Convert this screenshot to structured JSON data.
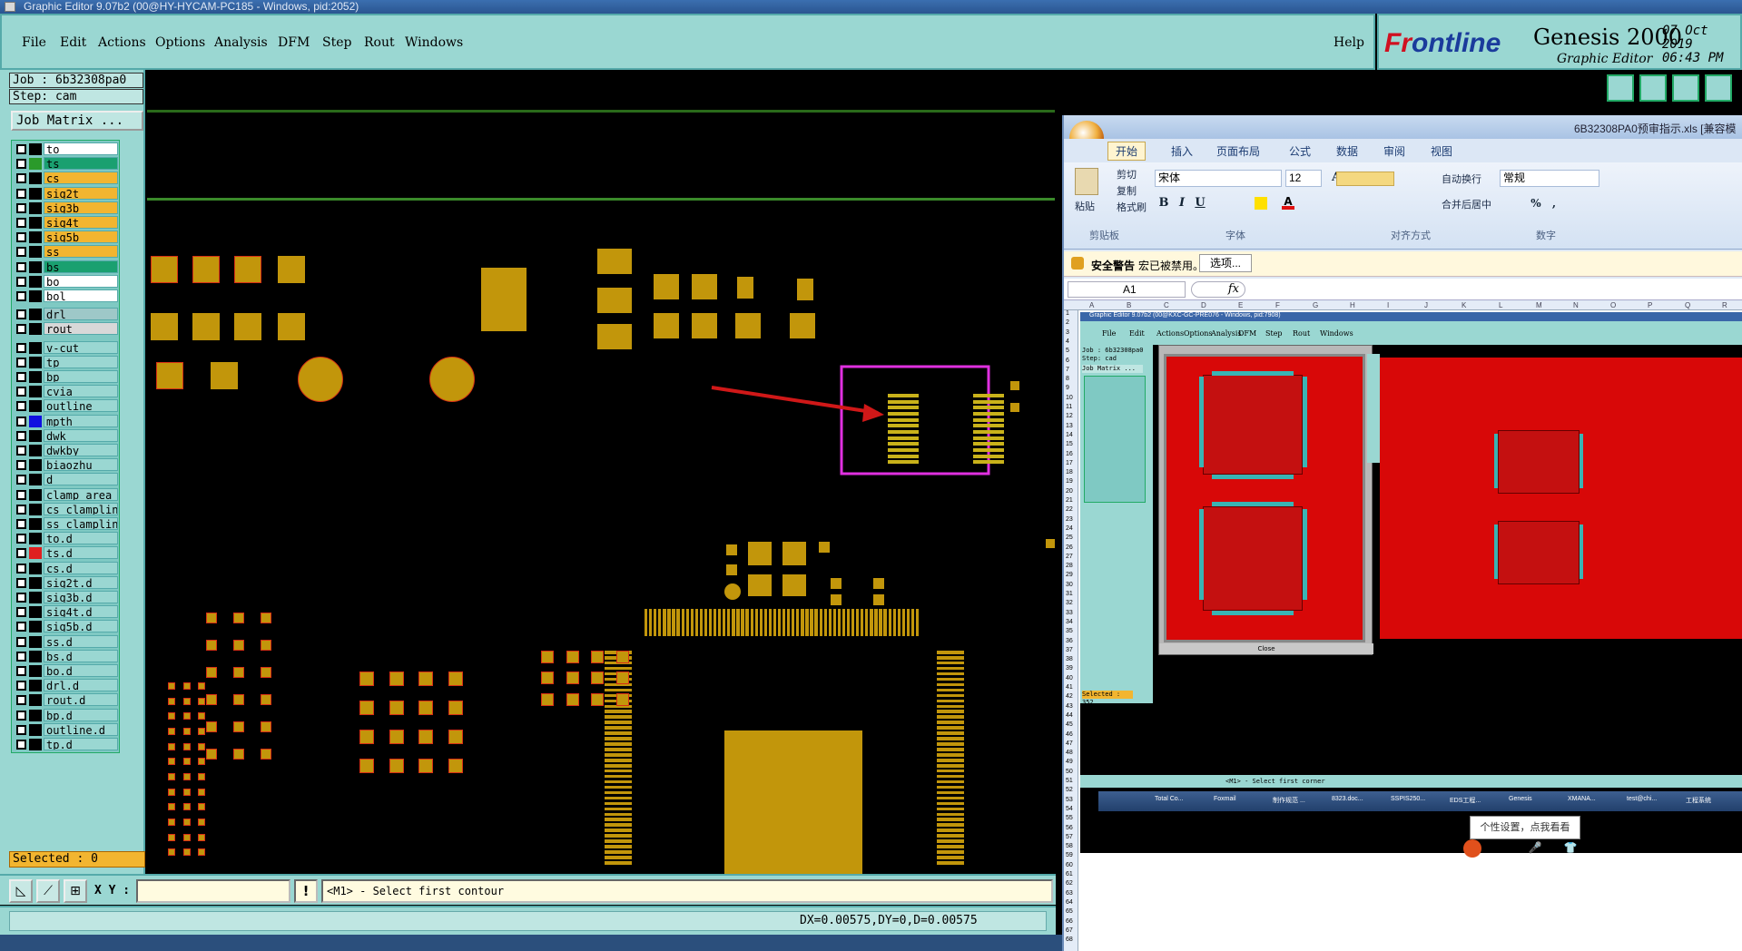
{
  "window": {
    "title": "Graphic Editor 9.07b2 (00@HY-HYCAM-PC185 - Windows, pid:2052)"
  },
  "menu": {
    "items": [
      "File",
      "Edit",
      "Actions",
      "Options",
      "Analysis",
      "DFM",
      "Step",
      "Rout",
      "Windows"
    ],
    "help": "Help"
  },
  "branding": {
    "logo_a": "Fr",
    "logo_b": "ontline",
    "product": "Genesis 2000",
    "subtitle": "Graphic Editor",
    "date": "07 Oct 2019",
    "time": "06:43 PM"
  },
  "job": {
    "job_label": "Job : 6b32308pa0",
    "step_label": "Step: cam",
    "matrix_button": "Job Matrix ..."
  },
  "layers": [
    {
      "name": "to",
      "color": "#ffffff",
      "sw": "#000000"
    },
    {
      "name": "ts",
      "color": "#1aa070",
      "sw": "#2a9a2a"
    },
    {
      "name": "cs",
      "color": "#f2b530",
      "sw": "#000000"
    },
    {
      "name": "sig2t",
      "color": "#f2b530",
      "sw": "#000000"
    },
    {
      "name": "sig3b",
      "color": "#f2b530",
      "sw": "#000000"
    },
    {
      "name": "sig4t",
      "color": "#f2b530",
      "sw": "#000000"
    },
    {
      "name": "sig5b",
      "color": "#f2b530",
      "sw": "#000000"
    },
    {
      "name": "ss",
      "color": "#f2b530",
      "sw": "#000000"
    },
    {
      "name": "bs",
      "color": "#1aa070",
      "sw": "#000000"
    },
    {
      "name": "bo",
      "color": "#ffffff",
      "sw": "#000000"
    },
    {
      "name": "bol",
      "color": "#ffffff",
      "sw": "#000000"
    },
    {
      "name": "drl",
      "color": "#9ec8c8",
      "sw": "#000000"
    },
    {
      "name": "rout",
      "color": "#d8d8d8",
      "sw": "#000000"
    },
    {
      "name": "v-cut",
      "color": "#9ad7d2",
      "sw": "#000000"
    },
    {
      "name": "tp",
      "color": "#9ad7d2",
      "sw": "#000000"
    },
    {
      "name": "bp",
      "color": "#9ad7d2",
      "sw": "#000000"
    },
    {
      "name": "cvia",
      "color": "#9ad7d2",
      "sw": "#000000"
    },
    {
      "name": "outline",
      "color": "#9ad7d2",
      "sw": "#000000"
    },
    {
      "name": "mpth",
      "color": "#9ad7d2",
      "sw": "#1010e0"
    },
    {
      "name": "dwk",
      "color": "#9ad7d2",
      "sw": "#000000"
    },
    {
      "name": "dwkby",
      "color": "#9ad7d2",
      "sw": "#000000"
    },
    {
      "name": "biaozhu",
      "color": "#9ad7d2",
      "sw": "#000000"
    },
    {
      "name": "d",
      "color": "#9ad7d2",
      "sw": "#000000"
    },
    {
      "name": "clamp_area",
      "color": "#9ad7d2",
      "sw": "#000000"
    },
    {
      "name": "cs_clampline",
      "color": "#9ad7d2",
      "sw": "#000000"
    },
    {
      "name": "ss_clampline",
      "color": "#9ad7d2",
      "sw": "#000000"
    },
    {
      "name": "to.d",
      "color": "#9ad7d2",
      "sw": "#000000"
    },
    {
      "name": "ts.d",
      "color": "#9ad7d2",
      "sw": "#e02020"
    },
    {
      "name": "cs.d",
      "color": "#9ad7d2",
      "sw": "#000000"
    },
    {
      "name": "sig2t.d",
      "color": "#9ad7d2",
      "sw": "#000000"
    },
    {
      "name": "sig3b.d",
      "color": "#9ad7d2",
      "sw": "#000000"
    },
    {
      "name": "sig4t.d",
      "color": "#9ad7d2",
      "sw": "#000000"
    },
    {
      "name": "sig5b.d",
      "color": "#9ad7d2",
      "sw": "#000000"
    },
    {
      "name": "ss.d",
      "color": "#9ad7d2",
      "sw": "#000000"
    },
    {
      "name": "bs.d",
      "color": "#9ad7d2",
      "sw": "#000000"
    },
    {
      "name": "bo.d",
      "color": "#9ad7d2",
      "sw": "#000000"
    },
    {
      "name": "drl.d",
      "color": "#9ad7d2",
      "sw": "#000000"
    },
    {
      "name": "rout.d",
      "color": "#9ad7d2",
      "sw": "#000000"
    },
    {
      "name": "bp.d",
      "color": "#9ad7d2",
      "sw": "#000000"
    },
    {
      "name": "outline.d",
      "color": "#9ad7d2",
      "sw": "#000000"
    },
    {
      "name": "tp.d",
      "color": "#9ad7d2",
      "sw": "#000000"
    }
  ],
  "selected": "Selected : 0",
  "command": {
    "xy_label": "X Y :",
    "bang": "!",
    "prompt": "<M1> - Select first contour"
  },
  "status": {
    "delta": "DX=0.00575,DY=0,D=0.00575"
  },
  "excel": {
    "doc_title": "6B32308PA0预审指示.xls  [兼容模式]",
    "tabs": [
      "开始",
      "插入",
      "页面布局",
      "公式",
      "数据",
      "审阅",
      "视图"
    ],
    "clipboard": {
      "paste": "粘贴",
      "cut": "剪切",
      "copy": "复制",
      "format_painter": "格式刷",
      "group": "剪贴板"
    },
    "font": {
      "name": "宋体",
      "size": "12",
      "group": "字体",
      "bold": "B",
      "italic": "I",
      "underline": "U",
      "inc": "A",
      "dec": "A"
    },
    "align": {
      "wrap": "自动换行",
      "merge": "合并后居中",
      "group": "对齐方式"
    },
    "number": {
      "format": "常规",
      "group": "数字",
      "pct": "%",
      "comma": ","
    },
    "security": {
      "title": "安全警告",
      "msg": "宏已被禁用。",
      "options": "选项..."
    },
    "name_box": "A1",
    "fx": "fx",
    "columns": [
      "A",
      "B",
      "C",
      "D",
      "E",
      "F",
      "G",
      "H",
      "I",
      "J",
      "K",
      "L",
      "M",
      "N",
      "O",
      "P",
      "Q",
      "R"
    ],
    "rows": [
      "1",
      "2",
      "3",
      "4",
      "5",
      "6",
      "7",
      "8",
      "9",
      "10",
      "11",
      "12",
      "13",
      "14",
      "15",
      "16",
      "17",
      "18",
      "19",
      "20",
      "21",
      "22",
      "23",
      "24",
      "25",
      "26",
      "27",
      "28",
      "29",
      "30",
      "31",
      "32",
      "33",
      "34",
      "35",
      "36",
      "37",
      "38",
      "39",
      "40",
      "41",
      "42",
      "43",
      "44",
      "45",
      "46",
      "47",
      "48",
      "49",
      "50",
      "51",
      "52",
      "53",
      "54",
      "55",
      "56",
      "57",
      "58",
      "59",
      "60",
      "61",
      "62",
      "63",
      "64",
      "65",
      "66",
      "67",
      "68"
    ],
    "tip": "个性设置，点我看看",
    "ime": "中 °, ☺ 🎤 ⌨ 👕 ▦"
  },
  "embedded": {
    "title": "Graphic Editor 9.07b2 (00@KXC-GC-PRE076 - Windows, pid:7908)",
    "menu": [
      "File",
      "Edit",
      "Actions",
      "Options",
      "Analysis",
      "DFM",
      "Step",
      "Rout",
      "Windows"
    ],
    "job": "Job : 6b32308pa0",
    "step": "Step: cad",
    "matrix": "Job Matrix ...",
    "selected": "Selected : 352",
    "prompt": "<M1> - Select first corner",
    "close": "Close",
    "tasks": [
      "Total Co...",
      "Foxmail",
      "制作规范 ...",
      "8323.doc...",
      "SSPIS250...",
      "EDS工程...",
      "Genesis",
      "XMANA...",
      "test@chi...",
      "工程系统"
    ]
  },
  "colors": {
    "panel": "#9ad7d2",
    "pad": "#c2960b",
    "pad_outline": "#d83014",
    "highlight": "#e030e0",
    "arrow": "#d01818",
    "board": "#d80808"
  }
}
